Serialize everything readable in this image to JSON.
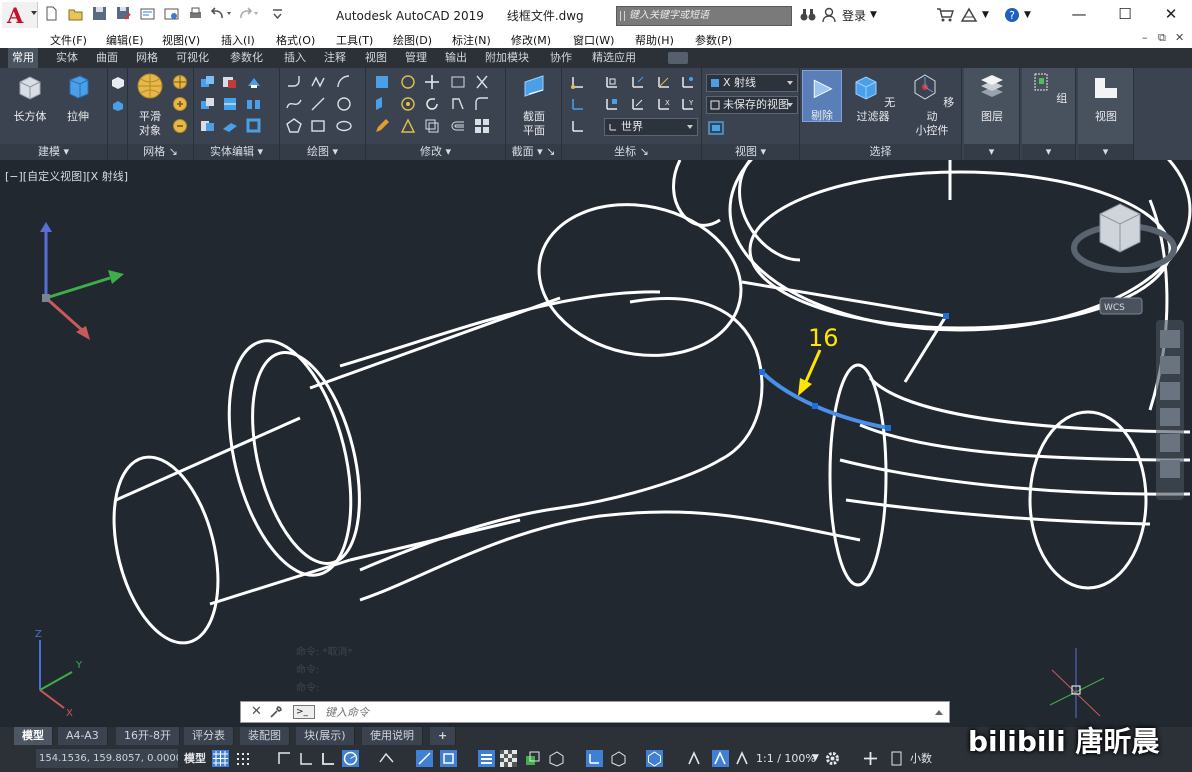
{
  "window": {
    "title": "Autodesk AutoCAD 2019",
    "filename": "线框文件.dwg",
    "search_placeholder": "键入关键字或短语",
    "login_label": "登录",
    "help_icon": "question-icon"
  },
  "app_logo": "A",
  "menubar": {
    "items": [
      "文件(F)",
      "编辑(E)",
      "视图(V)",
      "插入(I)",
      "格式(O)",
      "工具(T)",
      "绘图(D)",
      "标注(N)",
      "修改(M)",
      "窗口(W)",
      "帮助(H)",
      "参数(P)"
    ]
  },
  "ribbon_tabs": [
    "常用",
    "实体",
    "曲面",
    "网格",
    "可视化",
    "参数化",
    "插入",
    "注释",
    "视图",
    "管理",
    "输出",
    "附加模块",
    "协作",
    "精选应用"
  ],
  "ribbon": {
    "modeling": {
      "label": "建模",
      "box_label": "长方体",
      "extrude_label": "拉伸"
    },
    "mesh": {
      "label": "网格",
      "smooth_label_1": "平滑",
      "smooth_label_2": "对象"
    },
    "solid_edit": {
      "label": "实体编辑"
    },
    "draw": {
      "label": "绘图"
    },
    "modify": {
      "label": "修改"
    },
    "section": {
      "label": "截面",
      "plane_label_1": "截面",
      "plane_label_2": "平面"
    },
    "coords": {
      "label": "坐标",
      "ucs_value": "世界"
    },
    "view": {
      "label": "视图",
      "visual_style": "X 射线",
      "named_view": "未保存的视图"
    },
    "selection": {
      "label": "选择",
      "cull_label": "剔除",
      "filter_label": "无过滤器",
      "gizmo_label_1": "移动",
      "gizmo_label_2": "小控件"
    },
    "layers": {
      "label": "图层"
    },
    "groups": {
      "label": "组"
    },
    "view_panel": {
      "label": "视图"
    }
  },
  "viewport": {
    "label": "[−][自定义视图][X 射线]",
    "annotation": "16",
    "wcs_label": "WCS",
    "history_line_1": "命令: *取消*",
    "history_line_2": "命令:",
    "history_line_3": "命令:"
  },
  "command_line": {
    "placeholder": "键入命令"
  },
  "layout_tabs": [
    "模型",
    "A4-A3",
    "16开-8开",
    "评分表",
    "装配图",
    "块(展示)",
    "使用说明"
  ],
  "statusbar": {
    "coords": "154.1536, 159.8057, 0.0000",
    "model_label": "模型",
    "scale_label": "1:1 / 100%",
    "units_label": "小数"
  },
  "watermark": "bilibili 唐昕晨",
  "colors": {
    "viewport_bg": "#212830",
    "ribbon_bg": "#3b4350",
    "highlight_blue": "#3f7fd6",
    "annotation_yellow": "#ffe600"
  }
}
